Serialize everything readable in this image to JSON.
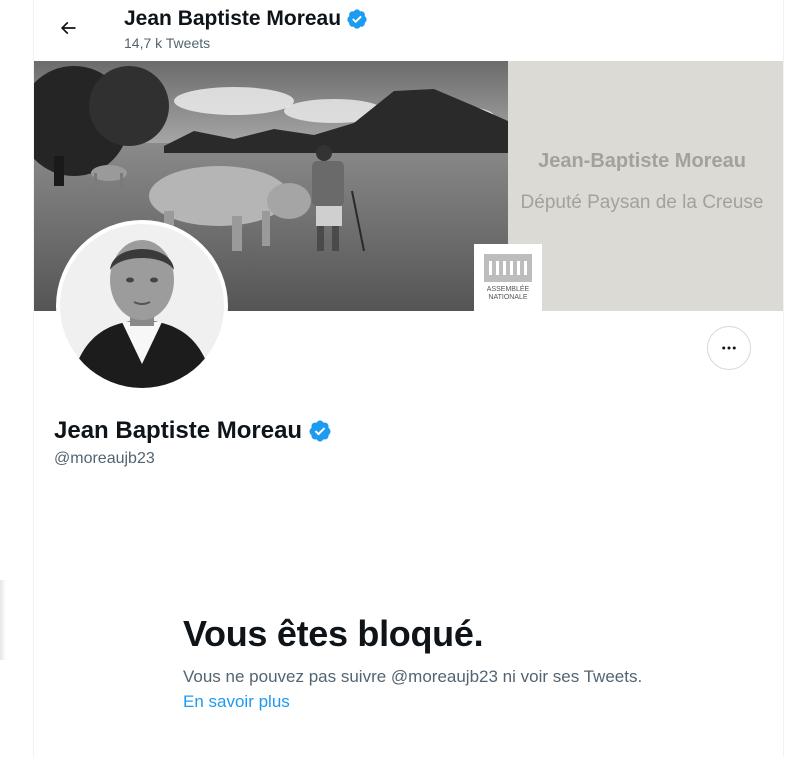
{
  "header": {
    "back_icon": "arrow-left-icon",
    "name": "Jean Baptiste Moreau",
    "tweet_count": "14,7 k Tweets",
    "verified_icon": "verified-badge-icon"
  },
  "banner": {
    "title": "Jean-Baptiste Moreau",
    "subtitle": "Député Paysan de la Creuse",
    "logo_text_line1": "ASSEMBLÉE",
    "logo_text_line2": "NATIONALE"
  },
  "profile": {
    "name": "Jean Baptiste Moreau",
    "handle": "@moreaujb23",
    "more_icon": "more-horizontal-icon"
  },
  "blocked": {
    "title": "Vous êtes bloqué.",
    "text": "Vous ne pouvez pas suivre @moreaujb23 ni voir ses Tweets.",
    "link": "En savoir plus"
  },
  "colors": {
    "accent": "#1d9bf0",
    "text_primary": "#0f1419",
    "text_secondary": "#536471",
    "border": "#eff3f4"
  }
}
